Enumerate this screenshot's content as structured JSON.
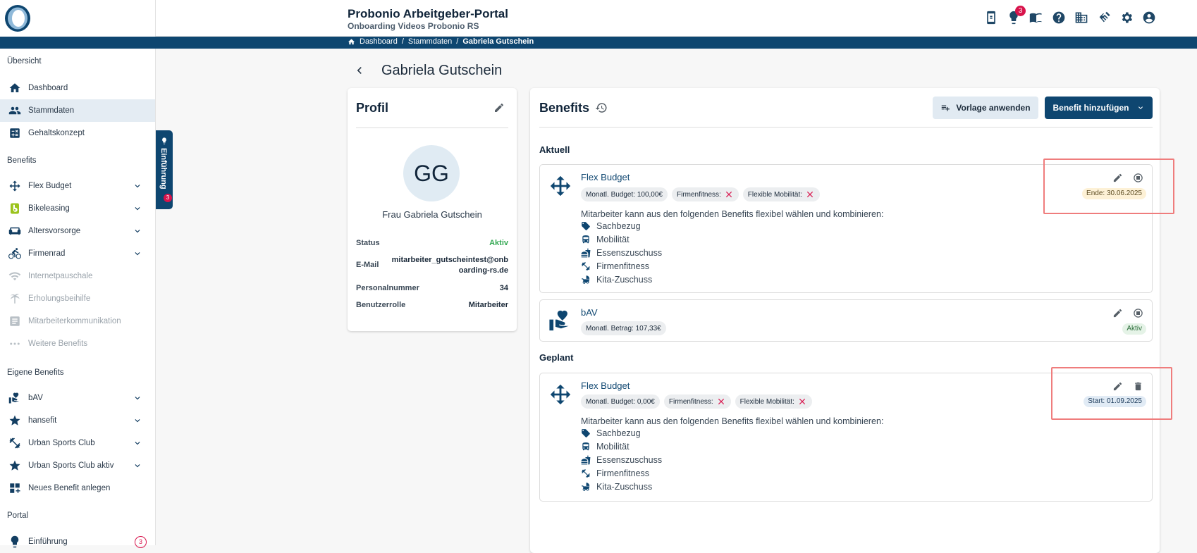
{
  "header": {
    "title": "Probonio Arbeitgeber-Portal",
    "subtitle": "Onboarding Videos Probonio RS",
    "notification_count": "3",
    "icons": [
      "phone-icon",
      "lightbulb-icon",
      "book-icon",
      "help-icon",
      "building-icon",
      "handshake-icon",
      "settings-icon",
      "account-icon"
    ]
  },
  "breadcrumb": {
    "items": [
      "Dashboard",
      "/",
      "Stammdaten",
      "/",
      "Gabriela Gutschein"
    ]
  },
  "sidebar": {
    "sections": [
      "Übersicht",
      "Benefits",
      "Eigene Benefits",
      "Portal"
    ],
    "items": [
      {
        "label": "Dashboard",
        "icon": "home-icon"
      },
      {
        "label": "Stammdaten",
        "icon": "people-icon",
        "active": true
      },
      {
        "label": "Gehaltskonzept",
        "icon": "calculator-icon"
      },
      {
        "label": "Flex Budget",
        "icon": "arrows-icon"
      },
      {
        "label": "Bikeleasing",
        "icon": "bikeleasing-icon"
      },
      {
        "label": "Altersvorsorge",
        "icon": "sofa-icon"
      },
      {
        "label": "Firmenrad",
        "icon": "bike-icon"
      },
      {
        "label": "Internetpauschale",
        "icon": "wifi-icon"
      },
      {
        "label": "Erholungsbeihilfe",
        "icon": "palm-icon"
      },
      {
        "label": "Mitarbeiterkommunikation",
        "icon": "document-icon"
      },
      {
        "label": "Weitere Benefits",
        "icon": "more-icon"
      },
      {
        "label": "bAV",
        "icon": "hand-heart-icon"
      },
      {
        "label": "hansefit",
        "icon": "star-icon"
      },
      {
        "label": "Urban Sports Club",
        "icon": "fitness-icon"
      },
      {
        "label": "Urban Sports Club aktiv",
        "icon": "star-icon"
      },
      {
        "label": "Neues Benefit anlegen",
        "icon": "dashboard-add-icon"
      },
      {
        "label": "Einführung",
        "icon": "lightbulb-icon",
        "count": "3"
      }
    ]
  },
  "intro_tab": {
    "label": "Einführung",
    "count": "3"
  },
  "page": {
    "title": "Gabriela Gutschein"
  },
  "profile": {
    "heading": "Profil",
    "initials": "GG",
    "name": "Frau Gabriela Gutschein",
    "rows": [
      {
        "label": "Status",
        "value": "Aktiv"
      },
      {
        "label": "E-Mail",
        "value_line1": "mitarbeiter_gutscheintest@onb",
        "value_line2": "oarding-rs.de"
      },
      {
        "label": "Personalnummer",
        "value": "34"
      },
      {
        "label": "Benutzerrolle",
        "value": "Mitarbeiter"
      }
    ]
  },
  "benefits": {
    "heading": "Benefits",
    "template_button": "Vorlage anwenden",
    "add_button": "Benefit hinzufügen",
    "group_current": "Aktuell",
    "group_planned": "Geplant",
    "desc": "Mitarbeiter kann aus den folgenden Benefits flexibel wählen und kombinieren:",
    "sub_items": [
      "Sachbezug",
      "Mobilität",
      "Essenszuschuss",
      "Firmenfitness",
      "Kita-Zuschuss"
    ],
    "current": [
      {
        "name": "Flex Budget",
        "chips": [
          "Monatl. Budget: 100,00€",
          "Firmenfitness:",
          "Flexible Mobilität:"
        ],
        "status": "Ende: 30.06.2025"
      },
      {
        "name": "bAV",
        "chips": [
          "Monatl. Betrag: 107,33€"
        ],
        "status": "Aktiv"
      }
    ],
    "planned": [
      {
        "name": "Flex Budget",
        "chips": [
          "Monatl. Budget: 0,00€",
          "Firmenfitness:",
          "Flexible Mobilität:"
        ],
        "status": "Start: 01.09.2025"
      }
    ]
  },
  "colors": {
    "primary": "#0e4670",
    "accent": "#d8134b",
    "highlight": "#ef7d7d"
  }
}
